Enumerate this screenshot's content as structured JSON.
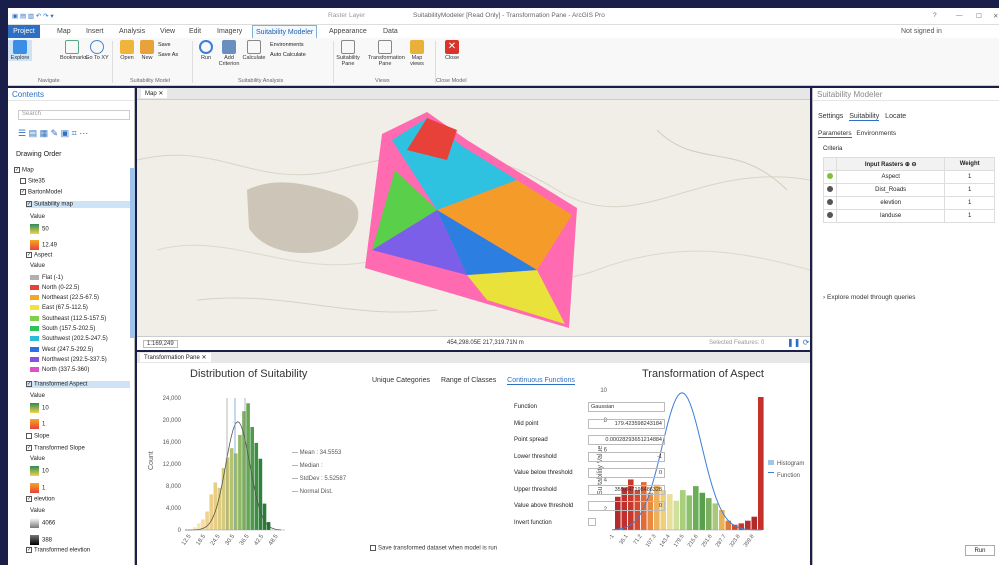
{
  "window": {
    "title": "SuitabilityModeler [Read Only] - Transformation Pane - ArcGIS Pro",
    "context": "Raster Layer",
    "help": "?",
    "signin": "Not signed in"
  },
  "tabs": [
    "Project",
    "Map",
    "Insert",
    "Analysis",
    "View",
    "Edit",
    "Imagery",
    "Suitability Modeler",
    "Appearance",
    "Data"
  ],
  "ribbon": {
    "buttons": [
      "Explore",
      "Bookmarks",
      "Go To XY",
      "Open",
      "New",
      "Save",
      "Save As",
      "Run",
      "Add Criterion",
      "Calculate",
      "Environments",
      "Auto Calculate",
      "Suitability Pane",
      "Transformation Pane",
      "Map views",
      "Close"
    ],
    "groups": [
      "Navigate",
      "Suitability Model",
      "Suitability Analysis",
      "Views",
      "Close Model"
    ]
  },
  "contents": {
    "title": "Contents",
    "search_placeholder": "Search",
    "drawing_order": "Drawing Order",
    "items": [
      {
        "label": "Map"
      },
      {
        "label": "Site35"
      },
      {
        "label": "BartonModel"
      },
      {
        "label": "Suitability map"
      },
      {
        "label": "Value"
      },
      {
        "label": "50"
      },
      {
        "label": "12.49"
      },
      {
        "label": "Aspect"
      },
      {
        "label": "Value"
      },
      {
        "label": "Flat (-1)"
      },
      {
        "label": "North (0-22.5)"
      },
      {
        "label": "Northeast (22.5-67.5)"
      },
      {
        "label": "East (67.5-112.5)"
      },
      {
        "label": "Southeast (112.5-157.5)"
      },
      {
        "label": "South (157.5-202.5)"
      },
      {
        "label": "Southwest (202.5-247.5)"
      },
      {
        "label": "West (247.5-292.5)"
      },
      {
        "label": "Northwest (292.5-337.5)"
      },
      {
        "label": "North (337.5-360)"
      },
      {
        "label": "Transformed Aspect"
      },
      {
        "label": "Value"
      },
      {
        "label": "10"
      },
      {
        "label": "1"
      },
      {
        "label": "Slope"
      },
      {
        "label": "Transformed Slope"
      },
      {
        "label": "Value"
      },
      {
        "label": "10"
      },
      {
        "label": "1"
      },
      {
        "label": "elevtion"
      },
      {
        "label": "Value"
      },
      {
        "label": "4066"
      },
      {
        "label": "388"
      },
      {
        "label": "Transformed elevtion"
      }
    ],
    "aspect_colors": [
      "#b0b0b0",
      "#e8413a",
      "#f5a623",
      "#f2e33b",
      "#7fd04a",
      "#2ec25a",
      "#2bbcd8",
      "#2d6fe8",
      "#8a4fe0",
      "#e04fc8"
    ]
  },
  "map": {
    "tab": "Map",
    "scale": "1:169,249",
    "coords": "454,298.05E 217,319.71N m",
    "selected": "Selected Features: 0"
  },
  "tpane": {
    "tab": "Transformation Pane",
    "hist_title": "Distribution of Suitability",
    "hist_ylabel": "Count",
    "hist_yticks": [
      "24,000",
      "20,000",
      "16,000",
      "12,000",
      "8,000",
      "4,000",
      "0"
    ],
    "hist_xticks": [
      "12.5",
      "18.5",
      "24.5",
      "30.5",
      "36.5",
      "42.5",
      "48.5"
    ],
    "legend": [
      "Mean : 34.5553",
      "Median :",
      "StdDev : 5.52587",
      "Normal Dist."
    ],
    "subtabs": [
      "Unique Categories",
      "Range of Classes",
      "Continuous Functions"
    ],
    "fields": [
      {
        "label": "Function",
        "value": "Gaussian"
      },
      {
        "label": "Mid point",
        "value": "179.423598243184"
      },
      {
        "label": "Point spread",
        "value": "0.00028293651214884"
      },
      {
        "label": "Lower threshold",
        "value": "-1"
      },
      {
        "label": "Value below threshold",
        "value": "0"
      },
      {
        "label": "Upper threshold",
        "value": "359.847198486328"
      },
      {
        "label": "Value above threshold",
        "value": "0"
      },
      {
        "label": "Invert function",
        "value": ""
      }
    ],
    "save_label": "Save transformed dataset when model is run",
    "tr_title": "Transformation of Aspect",
    "tr_ylabel": "Suitability Value",
    "tr_yticks": [
      "10",
      "8",
      "6",
      "4",
      "2"
    ],
    "tr_xticks": [
      "-1",
      "35.1",
      "71.2",
      "107.3",
      "143.4",
      "179.5",
      "215.6",
      "251.6",
      "287.7",
      "323.8",
      "359.8"
    ],
    "tr_legend": [
      "Histogram",
      "Function"
    ]
  },
  "right": {
    "title": "Suitability Modeler",
    "tabs": [
      "Settings",
      "Suitability",
      "Locate"
    ],
    "subtabs": [
      "Parameters",
      "Environments"
    ],
    "criteria": "Criteria",
    "col_raster": "Input Rasters",
    "col_weight": "Weight",
    "rows": [
      {
        "name": "Aspect",
        "weight": "1",
        "status": "#7fc23a"
      },
      {
        "name": "Dist_Roads",
        "weight": "1",
        "status": "#555"
      },
      {
        "name": "elevtion",
        "weight": "1",
        "status": "#555"
      },
      {
        "name": "landuse",
        "weight": "1",
        "status": "#555"
      }
    ],
    "explore": "Explore model through queries",
    "run": "Run"
  }
}
